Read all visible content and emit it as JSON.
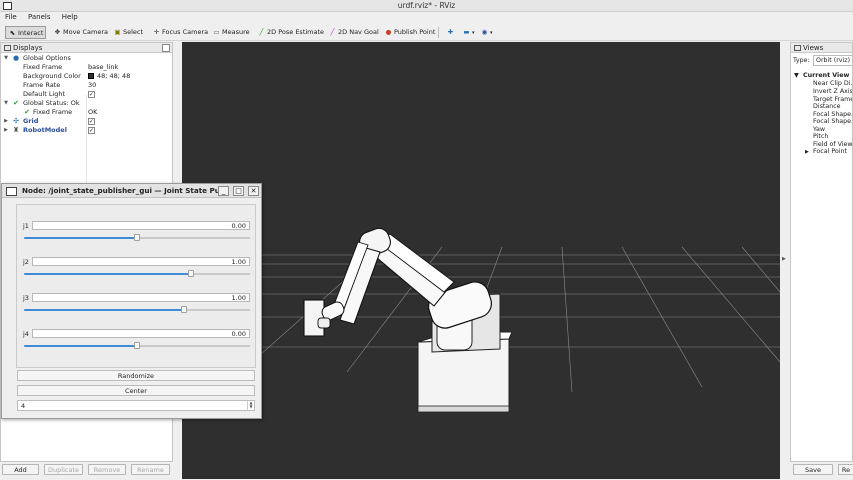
{
  "window": {
    "title": "urdf.rviz* - RViz"
  },
  "menu": [
    "File",
    "Panels",
    "Help"
  ],
  "toolbar": {
    "interact": "Interact",
    "move_camera": "Move Camera",
    "select": "Select",
    "focus_camera": "Focus Camera",
    "measure": "Measure",
    "pose_estimate": "2D Pose Estimate",
    "nav_goal": "2D Nav Goal",
    "publish_point": "Publish Point"
  },
  "displays": {
    "title": "Displays",
    "global_options": "Global Options",
    "fixed_frame_label": "Fixed Frame",
    "fixed_frame_value": "base_link",
    "background_label": "Background Color",
    "background_value": "48; 48; 48",
    "frame_rate_label": "Frame Rate",
    "frame_rate_value": "30",
    "default_light_label": "Default Light",
    "global_status": "Global Status: Ok",
    "status_fixed_frame": "Fixed Frame",
    "status_fixed_frame_value": "OK",
    "grid": "Grid",
    "robot_model": "RobotModel",
    "buttons": {
      "add": "Add",
      "duplicate": "Duplicate",
      "remove": "Remove",
      "rename": "Rename"
    }
  },
  "views": {
    "title": "Views",
    "type_label": "Type:",
    "type_value": "Orbit (rviz)",
    "current_view": "Current View",
    "items": [
      "Near Clip Di...",
      "Invert Z Axis",
      "Target Frame",
      "Distance",
      "Focal Shape...",
      "Focal Shape...",
      "Yaw",
      "Pitch",
      "Field of View",
      "Focal Point"
    ],
    "save": "Save",
    "remove": "Re"
  },
  "dialog": {
    "title": "Node: /joint_state_publisher_gui — Joint State Pu...",
    "joints": [
      {
        "name": "j1",
        "value": "0.00",
        "position": 0.5
      },
      {
        "name": "j2",
        "value": "1.00",
        "position": 0.74
      },
      {
        "name": "j3",
        "value": "1.00",
        "position": 0.71
      },
      {
        "name": "j4",
        "value": "0.00",
        "position": 0.5
      }
    ],
    "randomize": "Randomize",
    "center": "Center",
    "spin_value": "4"
  },
  "colors": {
    "slider_fill": "#3f8dd8",
    "viewport_bg": "#303030"
  }
}
